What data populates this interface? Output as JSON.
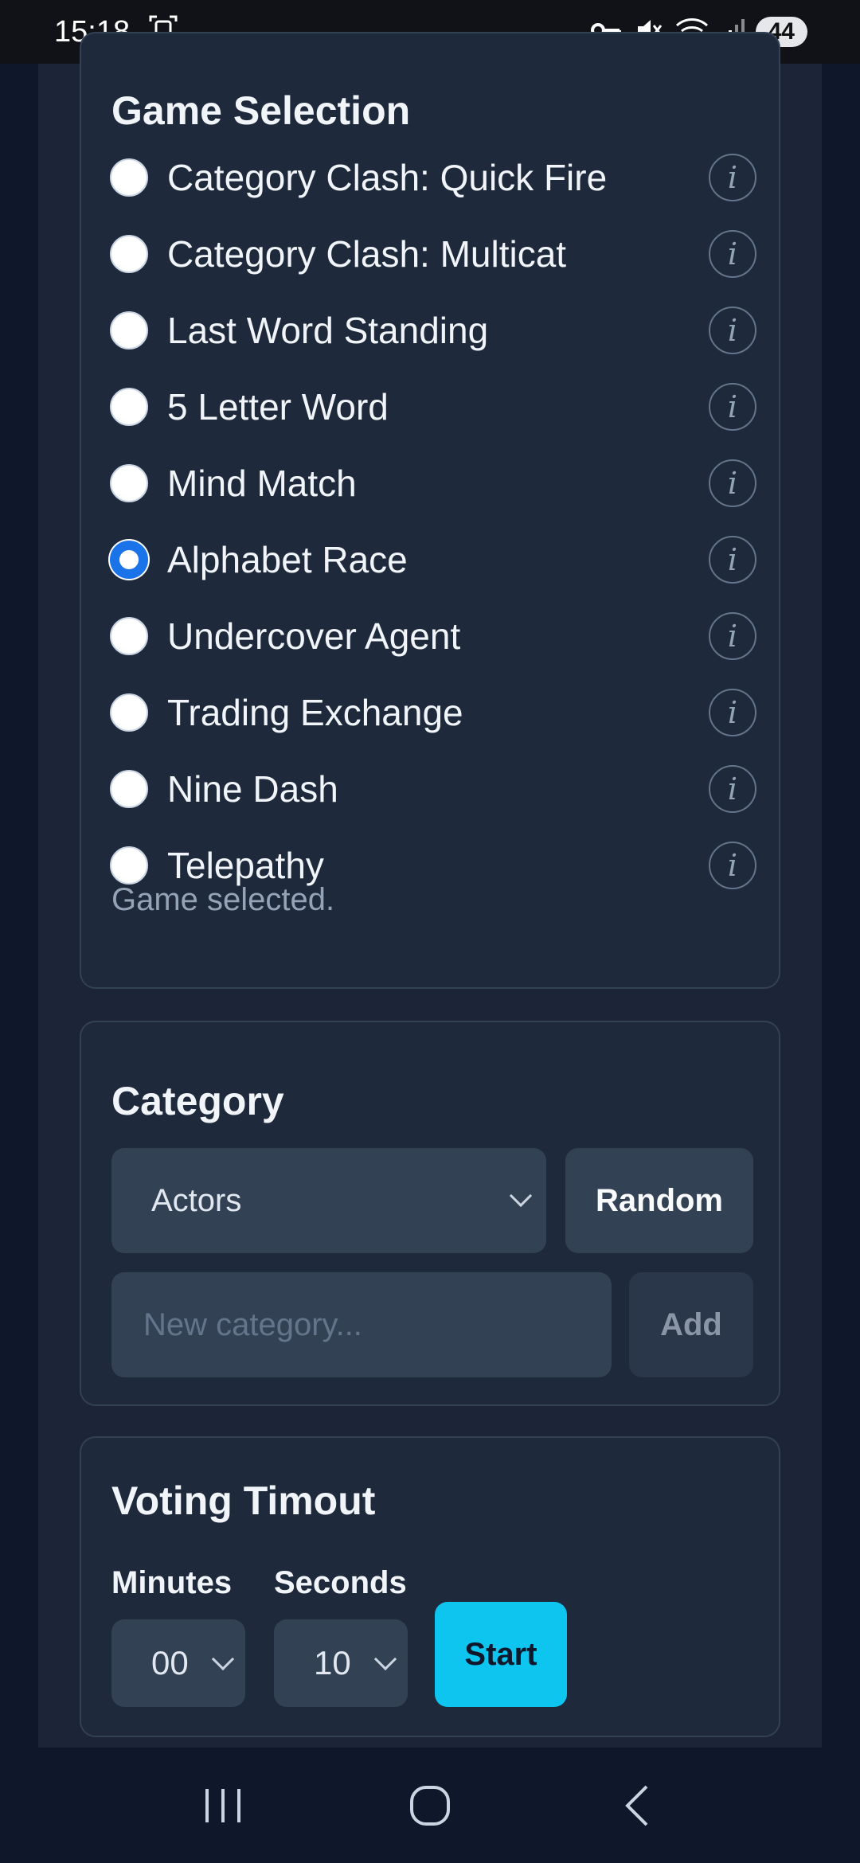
{
  "status_bar": {
    "time": "15:18",
    "battery": "44",
    "icons": [
      "screenshot-icon",
      "key-icon",
      "mute-icon",
      "wifi-icon",
      "signal-icon"
    ]
  },
  "game_selection": {
    "title": "Game Selection",
    "games": [
      {
        "label": "Category Clash: Quick Fire",
        "selected": false
      },
      {
        "label": "Category Clash: Multicat",
        "selected": false
      },
      {
        "label": "Last Word Standing",
        "selected": false
      },
      {
        "label": "5 Letter Word",
        "selected": false
      },
      {
        "label": "Mind Match",
        "selected": false
      },
      {
        "label": "Alphabet Race",
        "selected": true
      },
      {
        "label": "Undercover Agent",
        "selected": false
      },
      {
        "label": "Trading Exchange",
        "selected": false
      },
      {
        "label": "Nine Dash",
        "selected": false
      },
      {
        "label": "Telepathy",
        "selected": false
      }
    ],
    "info_icon": "i",
    "status": "Game selected."
  },
  "category": {
    "title": "Category",
    "selected": "Actors",
    "random_label": "Random",
    "new_placeholder": "New category...",
    "add_label": "Add"
  },
  "voting": {
    "title": "Voting Timout",
    "minutes_label": "Minutes",
    "minutes_value": "00",
    "seconds_label": "Seconds",
    "seconds_value": "10",
    "start_label": "Start"
  },
  "colors": {
    "accent": "#0ec5f0",
    "radio_selected": "#1a73e8",
    "card": "#1e293b",
    "background": "#0f172a"
  }
}
